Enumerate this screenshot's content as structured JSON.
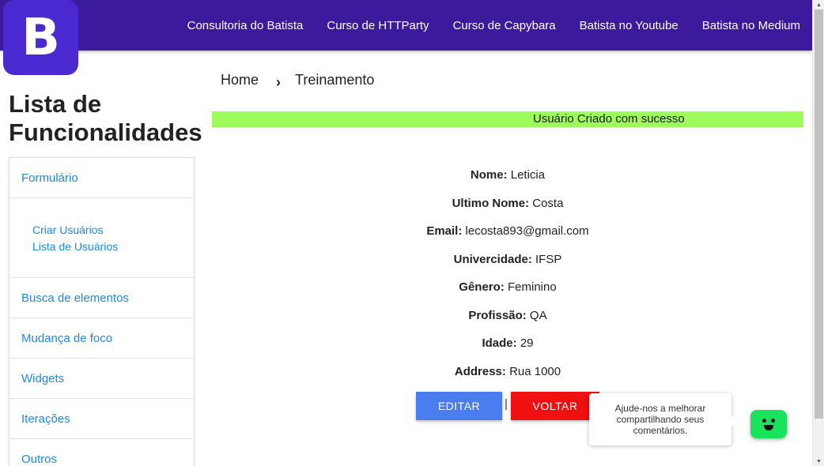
{
  "logo": {
    "letter": "B"
  },
  "nav": {
    "items": [
      "Consultoria do Batista",
      "Curso de HTTParty",
      "Curso de Capybara",
      "Batista no Youtube",
      "Batista no Medium"
    ]
  },
  "sidebar": {
    "title_line1": "Lista de",
    "title_line2": "Funcionalidades",
    "formulario": "Formulário",
    "sub_items": [
      "Criar Usuários",
      "Lista de Usuários"
    ],
    "busca": "Busca de elementos",
    "mudanca": "Mudança de foco",
    "widgets": "Widgets",
    "iteracoes": "Iterações",
    "outros": "Outros"
  },
  "breadcrumb": {
    "home": "Home",
    "chevron": "›",
    "current": "Treinamento"
  },
  "toast": {
    "message": "Usuário Criado com sucesso"
  },
  "user": {
    "fields": [
      {
        "label": "Nome:",
        "value": "Leticia"
      },
      {
        "label": "Ultimo Nome:",
        "value": "Costa"
      },
      {
        "label": "Email:",
        "value": "lecosta893@gmail.com"
      },
      {
        "label": "Univercidade:",
        "value": "IFSP"
      },
      {
        "label": "Gênero:",
        "value": "Feminino"
      },
      {
        "label": "Profissão:",
        "value": "QA"
      },
      {
        "label": "Idade:",
        "value": "29"
      },
      {
        "label": "Address:",
        "value": "Rua 1000"
      }
    ]
  },
  "actions": {
    "edit": "EDITAR",
    "separator": "|",
    "back": "VOLTAR"
  },
  "feedback": {
    "tooltip": "Ajude-nos a melhorar compartilhando seus comentários.",
    "icon": "chatbot-face-icon"
  },
  "colors": {
    "header": "#3b1a9c",
    "logo": "#4a2ad0",
    "link": "#1e88e5",
    "toast": "#9dfb5b",
    "edit": "#4a7df0",
    "back": "#f01010",
    "chatbot": "#19e35a"
  }
}
